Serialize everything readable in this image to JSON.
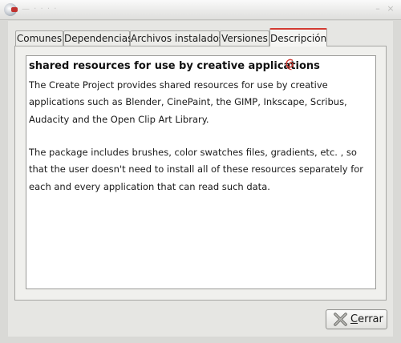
{
  "window": {
    "title": "— · · · ·",
    "title_buttons": [
      "–",
      "×"
    ]
  },
  "tabs": [
    {
      "label": "Comunes",
      "active": false
    },
    {
      "label": "Dependencias",
      "active": false
    },
    {
      "label": "Archivos instalados",
      "active": false
    },
    {
      "label": "Versiones",
      "active": false
    },
    {
      "label": "Descripción",
      "active": true
    }
  ],
  "description": {
    "title": "shared resources for use by creative applications",
    "paragraphs": [
      "The Create Project provides shared resources for use by creative applications such as Blender, CinePaint, the GIMP, Inkscape, Scribus, Audacity and the Open Clip Art Library.",
      "The package includes brushes, color swatches files, gradients, etc. , so that the user doesn't need to install all of these resources separately for each and every application that can read such data."
    ]
  },
  "buttons": {
    "close_accel": "C",
    "close_rest": "errar"
  },
  "icons": {
    "window_icon": "app-logo-icon",
    "distro_icon": "debian-swirl-icon",
    "close_icon": "close-x-icon"
  },
  "colors": {
    "accent": "#d33b32",
    "window_bg": "#e6e6e3"
  }
}
